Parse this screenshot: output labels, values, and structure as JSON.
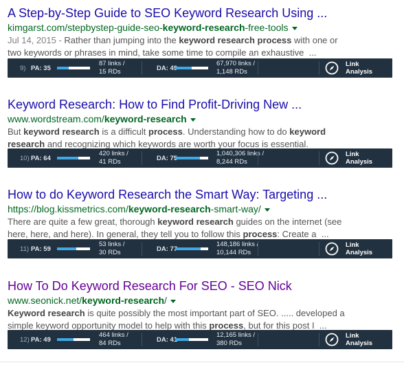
{
  "results": [
    {
      "title": "A Step-by-Step Guide to SEO Keyword Research Using ...",
      "visited": false,
      "url_parts": {
        "pre": "kimgarst.com/stepbystep-guide-seo-",
        "bold": "keyword-research",
        "post": "-free-tools"
      },
      "snippet_html": "<span class=\"date\">Jul 14, 2015 - </span>Rather than jumping into the <b>keyword research process</b> with one or two keywords or phrases in mind, take some time to compile an exhaustive &nbsp;...",
      "bar": {
        "rank": "9)",
        "pa_label": "PA: 35",
        "pa_value": 35,
        "pa_links": "87 links /",
        "pa_rds": "15 RDs",
        "da_label": "DA: 49",
        "da_value": 49,
        "da_links": "67,970 links /",
        "da_rds": "1,148 RDs",
        "link_analysis": "Link Analysis"
      }
    },
    {
      "title": "Keyword Research: How to Find Profit-Driving New ...",
      "visited": false,
      "url_parts": {
        "pre": "www.wordstream.com/",
        "bold": "keyword-research",
        "post": ""
      },
      "snippet_html": "But <b>keyword research</b> is a difficult <b>process</b>. Understanding how to do <b>keyword research</b> and recognizing which keywords are worth your focus is essential.",
      "bar": {
        "rank": "10)",
        "pa_label": "PA: 64",
        "pa_value": 64,
        "pa_links": "420 links /",
        "pa_rds": "41 RDs",
        "da_label": "DA: 75",
        "da_value": 75,
        "da_links": "1,040,306 links /",
        "da_rds": "8,244 RDs",
        "link_analysis": "Link Analysis"
      }
    },
    {
      "title": "How to do Keyword Research the Smart Way: Targeting ...",
      "visited": false,
      "url_parts": {
        "pre": "https://blog.kissmetrics.com/",
        "bold": "keyword-research",
        "post": "-smart-way/"
      },
      "snippet_html": "There are quite a few great, thorough <b>keyword research</b> guides on the internet (see here, here, and here). In general, they tell you to follow this <b>process</b>: Create a &nbsp;...",
      "bar": {
        "rank": "11)",
        "pa_label": "PA: 59",
        "pa_value": 59,
        "pa_links": "53 links /",
        "pa_rds": "30 RDs",
        "da_label": "DA: 77",
        "da_value": 77,
        "da_links": "148,186 links /",
        "da_rds": "10,144 RDs",
        "link_analysis": "Link Analysis"
      }
    },
    {
      "title": "How To Do Keyword Research For SEO - SEO Nick",
      "visited": true,
      "url_parts": {
        "pre": "www.seonick.net/",
        "bold": "keyword-research",
        "post": "/"
      },
      "snippet_html": "<b>Keyword research</b> is quite possibly the most important part of SEO. ..... developed a simple keyword opportunity model to help with this <b>process</b>, but for this post I &nbsp;...",
      "bar": {
        "rank": "12)",
        "pa_label": "PA: 49",
        "pa_value": 49,
        "pa_links": "464 links /",
        "pa_rds": "84 RDs",
        "da_label": "DA: 41",
        "da_value": 41,
        "da_links": "12,165 links /",
        "da_rds": "380 RDs",
        "link_analysis": "Link Analysis"
      }
    }
  ],
  "colors": {
    "link": "#1a0dab",
    "visited": "#660099",
    "url": "#006621",
    "bar_bg": "#22313f",
    "meter": "#3fa9e6"
  },
  "icons": {
    "dropdown": "caret-down-icon",
    "link_analysis": "compass-icon"
  }
}
